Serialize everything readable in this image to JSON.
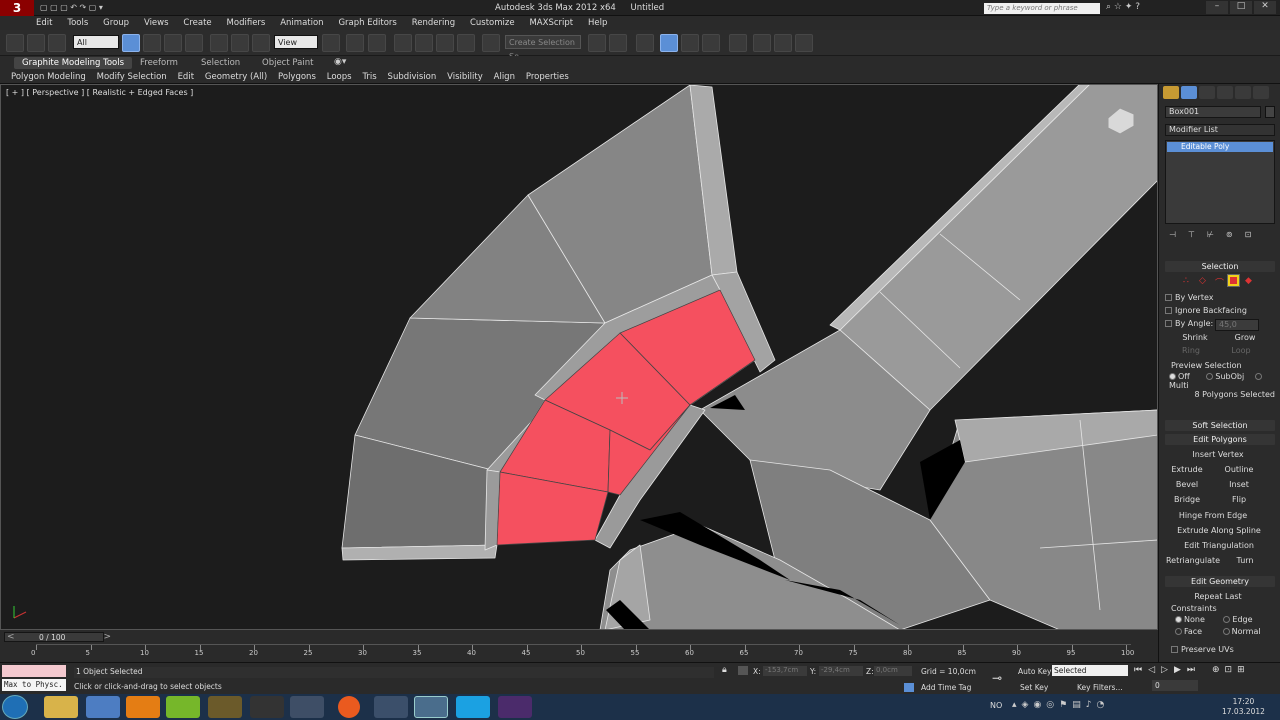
{
  "title": {
    "app": "Autodesk 3ds Max 2012 x64",
    "doc": "Untitled",
    "search_placeholder": "Type a keyword or phrase"
  },
  "menu": [
    "Edit",
    "Tools",
    "Group",
    "Views",
    "Create",
    "Modifiers",
    "Animation",
    "Graph Editors",
    "Rendering",
    "Customize",
    "MAXScript",
    "Help"
  ],
  "toolbar": {
    "filter_value": "All",
    "refcoord_value": "View",
    "named_sel_value": "Create Selection Se"
  },
  "ribbon": {
    "tabs": [
      "Graphite Modeling Tools",
      "Freeform",
      "Selection",
      "Object Paint"
    ],
    "items": [
      "Polygon Modeling",
      "Modify Selection",
      "Edit",
      "Geometry (All)",
      "Polygons",
      "Loops",
      "Tris",
      "Subdivision",
      "Visibility",
      "Align",
      "Properties"
    ]
  },
  "viewport": {
    "label": "[ + ] [ Perspective ] [ Realistic + Edged Faces ]"
  },
  "panel": {
    "object_name": "Box001",
    "modifier_list": "Modifier List",
    "stack_item": "Editable Poly",
    "selection": {
      "title": "Selection",
      "by_vertex": "By Vertex",
      "ignore_backfacing": "Ignore Backfacing",
      "by_angle": "By Angle:",
      "angle_value": "45,0",
      "shrink": "Shrink",
      "grow": "Grow",
      "ring": "Ring",
      "loop": "Loop",
      "preview": "Preview Selection",
      "off": "Off",
      "subobj": "SubObj",
      "multi": "Multi",
      "status": "8 Polygons Selected"
    },
    "soft_selection": "Soft Selection",
    "edit_polygons": {
      "title": "Edit Polygons",
      "insert_vertex": "Insert Vertex",
      "extrude": "Extrude",
      "outline": "Outline",
      "bevel": "Bevel",
      "inset": "Inset",
      "bridge": "Bridge",
      "flip": "Flip",
      "hinge": "Hinge From Edge",
      "extrude_spline": "Extrude Along Spline",
      "edit_tri": "Edit Triangulation",
      "retriangulate": "Retriangulate",
      "turn": "Turn"
    },
    "edit_geometry": {
      "title": "Edit Geometry",
      "repeat_last": "Repeat Last",
      "constraints": "Constraints",
      "none": "None",
      "edge": "Edge",
      "face": "Face",
      "normal": "Normal",
      "preserve_uvs": "Preserve UVs"
    }
  },
  "timeline": {
    "frame_display": "0 / 100",
    "ticks": [
      "0",
      "5",
      "10",
      "15",
      "20",
      "25",
      "30",
      "35",
      "40",
      "45",
      "50",
      "55",
      "60",
      "65",
      "70",
      "75",
      "80",
      "85",
      "90",
      "95",
      "100"
    ]
  },
  "status": {
    "maxscript": "Max to Physc.",
    "objects": "1 Object Selected",
    "prompt": "Click or click-and-drag to select objects",
    "x_label": "X:",
    "x_value": "-153,7cm",
    "y_label": "Y:",
    "y_value": "-29,4cm",
    "z_label": "Z:",
    "z_value": "0,0cm",
    "grid": "Grid = 10,0cm",
    "add_time_tag": "Add Time Tag",
    "auto_key": "Auto Key",
    "set_key": "Set Key",
    "key_filters": "Key Filters...",
    "selected_value": "Selected",
    "frame_value": "0"
  },
  "taskbar": {
    "lang": "NO",
    "time": "17:20",
    "date": "17.03.2012"
  },
  "colors": {
    "selected_poly": "#f5505f",
    "mesh_gray": "#8a8a8a",
    "accent": "#5b8fd6"
  }
}
